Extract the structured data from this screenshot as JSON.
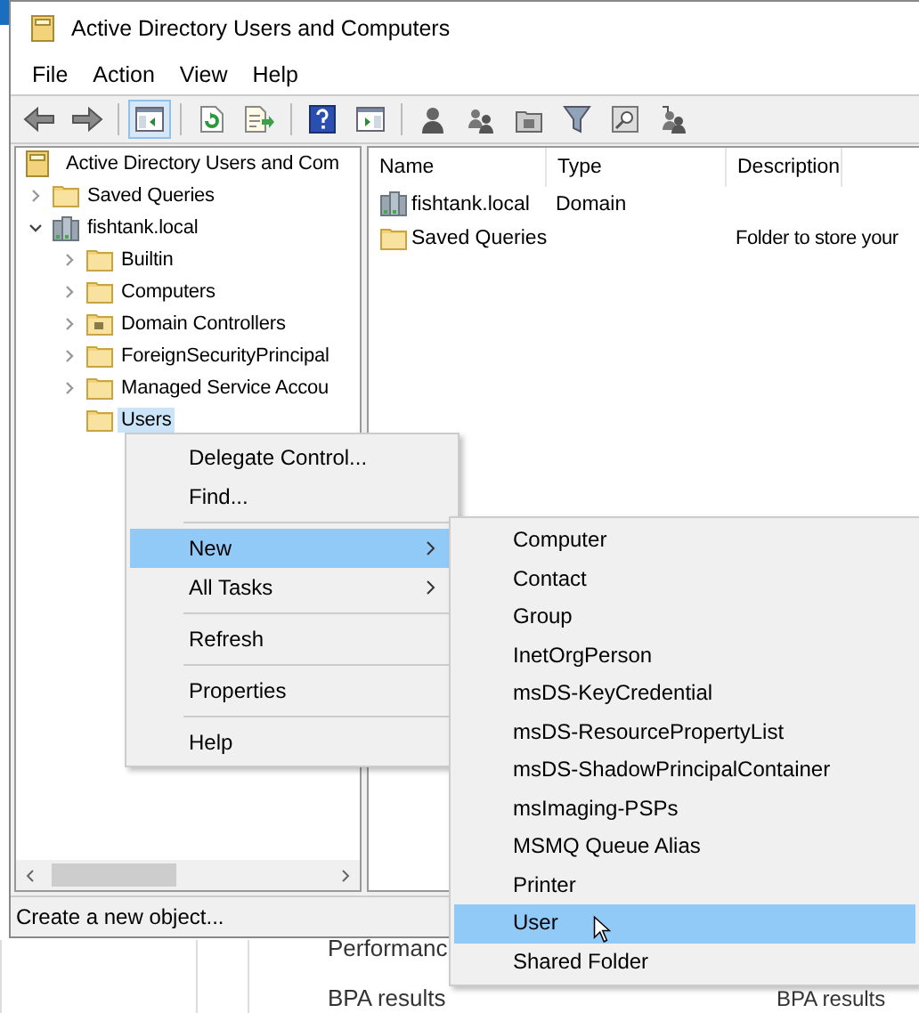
{
  "window": {
    "title": "Active Directory Users and Computers"
  },
  "menu_bar": [
    "File",
    "Action",
    "View",
    "Help"
  ],
  "toolbar": [
    {
      "kind": "back",
      "pressed": false
    },
    {
      "kind": "forward",
      "pressed": false
    },
    {
      "kind": "separator"
    },
    {
      "kind": "console-tree",
      "pressed": true
    },
    {
      "kind": "separator"
    },
    {
      "kind": "refresh",
      "pressed": false
    },
    {
      "kind": "export",
      "pressed": false
    },
    {
      "kind": "separator"
    },
    {
      "kind": "help",
      "pressed": false
    },
    {
      "kind": "action-pane",
      "pressed": false
    },
    {
      "kind": "separator"
    },
    {
      "kind": "new-user",
      "pressed": false
    },
    {
      "kind": "new-group",
      "pressed": false
    },
    {
      "kind": "new-ou",
      "pressed": false
    },
    {
      "kind": "filter",
      "pressed": false
    },
    {
      "kind": "find",
      "pressed": false
    },
    {
      "kind": "add-to-group",
      "pressed": false
    }
  ],
  "tree": {
    "label": "Active Directory Users and Com",
    "kind": "console",
    "selected": false,
    "children": [
      {
        "label": "Saved Queries",
        "kind": "folder",
        "expanded": false,
        "selected": false
      },
      {
        "label": "fishtank.local",
        "kind": "domain",
        "expanded": true,
        "selected": false,
        "children": [
          {
            "label": "Builtin",
            "kind": "folder",
            "expanded": false,
            "selected": false
          },
          {
            "label": "Computers",
            "kind": "folder",
            "expanded": false,
            "selected": false
          },
          {
            "label": "Domain Controllers",
            "kind": "ou",
            "expanded": false,
            "selected": false
          },
          {
            "label": "ForeignSecurityPrincipal",
            "kind": "folder",
            "expanded": false,
            "selected": false
          },
          {
            "label": "Managed Service Accou",
            "kind": "folder",
            "expanded": false,
            "selected": false
          },
          {
            "label": "Users",
            "kind": "folder",
            "selected": true
          }
        ]
      }
    ]
  },
  "list": {
    "columns": [
      "Name",
      "Type",
      "Description"
    ],
    "rows": [
      {
        "kind": "domain",
        "name": "fishtank.local",
        "type": "Domain"
      },
      {
        "kind": "folder",
        "name": "Saved Queries",
        "description": "Folder to store your"
      }
    ]
  },
  "status_bar": "Create a new object...",
  "background_texts": [
    "Performanc",
    "BPA results",
    "BPA results"
  ],
  "context_menu": [
    {
      "kind": "item",
      "label": "Delegate Control...",
      "selected": false
    },
    {
      "kind": "item",
      "label": "Find...",
      "selected": false
    },
    {
      "kind": "separator"
    },
    {
      "kind": "item",
      "label": "New",
      "selected": true,
      "submenu": true
    },
    {
      "kind": "item",
      "label": "All Tasks",
      "selected": false,
      "submenu": true
    },
    {
      "kind": "separator"
    },
    {
      "kind": "item",
      "label": "Refresh",
      "selected": false
    },
    {
      "kind": "separator"
    },
    {
      "kind": "item",
      "label": "Properties",
      "selected": false
    },
    {
      "kind": "separator"
    },
    {
      "kind": "item",
      "label": "Help",
      "selected": false
    }
  ],
  "submenu": [
    {
      "label": "Computer",
      "selected": false
    },
    {
      "label": "Contact",
      "selected": false
    },
    {
      "label": "Group",
      "selected": false
    },
    {
      "label": "InetOrgPerson",
      "selected": false
    },
    {
      "label": "msDS-KeyCredential",
      "selected": false
    },
    {
      "label": "msDS-ResourcePropertyList",
      "selected": false
    },
    {
      "label": "msDS-ShadowPrincipalContainer",
      "selected": false
    },
    {
      "label": "msImaging-PSPs",
      "selected": false
    },
    {
      "label": "MSMQ Queue Alias",
      "selected": false
    },
    {
      "label": "Printer",
      "selected": false
    },
    {
      "label": "User",
      "selected": true
    },
    {
      "label": "Shared Folder",
      "selected": false
    }
  ]
}
